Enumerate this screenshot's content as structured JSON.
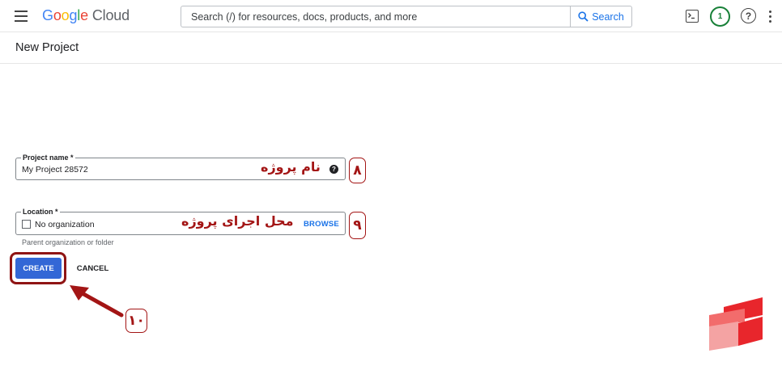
{
  "header": {
    "logo": {
      "google": [
        "G",
        "o",
        "o",
        "g",
        "l",
        "e"
      ],
      "product": "Cloud"
    },
    "search": {
      "placeholder": "Search (/) for resources, docs, products, and more",
      "button_label": "Search"
    },
    "notification_count": "1",
    "help_symbol": "?"
  },
  "page": {
    "title": "New Project"
  },
  "form": {
    "project_name": {
      "label": "Project name *",
      "value": "My Project 28572",
      "help_symbol": "?"
    },
    "location": {
      "label": "Location *",
      "value": "No organization",
      "browse_label": "BROWSE",
      "helper": "Parent organization or folder"
    },
    "buttons": {
      "create": "CREATE",
      "cancel": "CANCEL"
    }
  },
  "annotations": {
    "project_name_note": "نام پروژه",
    "project_name_step": "۸",
    "location_note": "محل اجرای پروژه",
    "location_step": "۹",
    "create_step": "۱۰"
  },
  "colors": {
    "accent": "#1a73e8",
    "create_button": "#3367d6",
    "annotation": "#a31515",
    "notification": "#188038"
  },
  "icons": [
    "menu-icon",
    "search-icon",
    "terminal-icon",
    "help-icon",
    "more-vert-icon",
    "organization-icon",
    "arrow-icon",
    "brand-logo"
  ]
}
